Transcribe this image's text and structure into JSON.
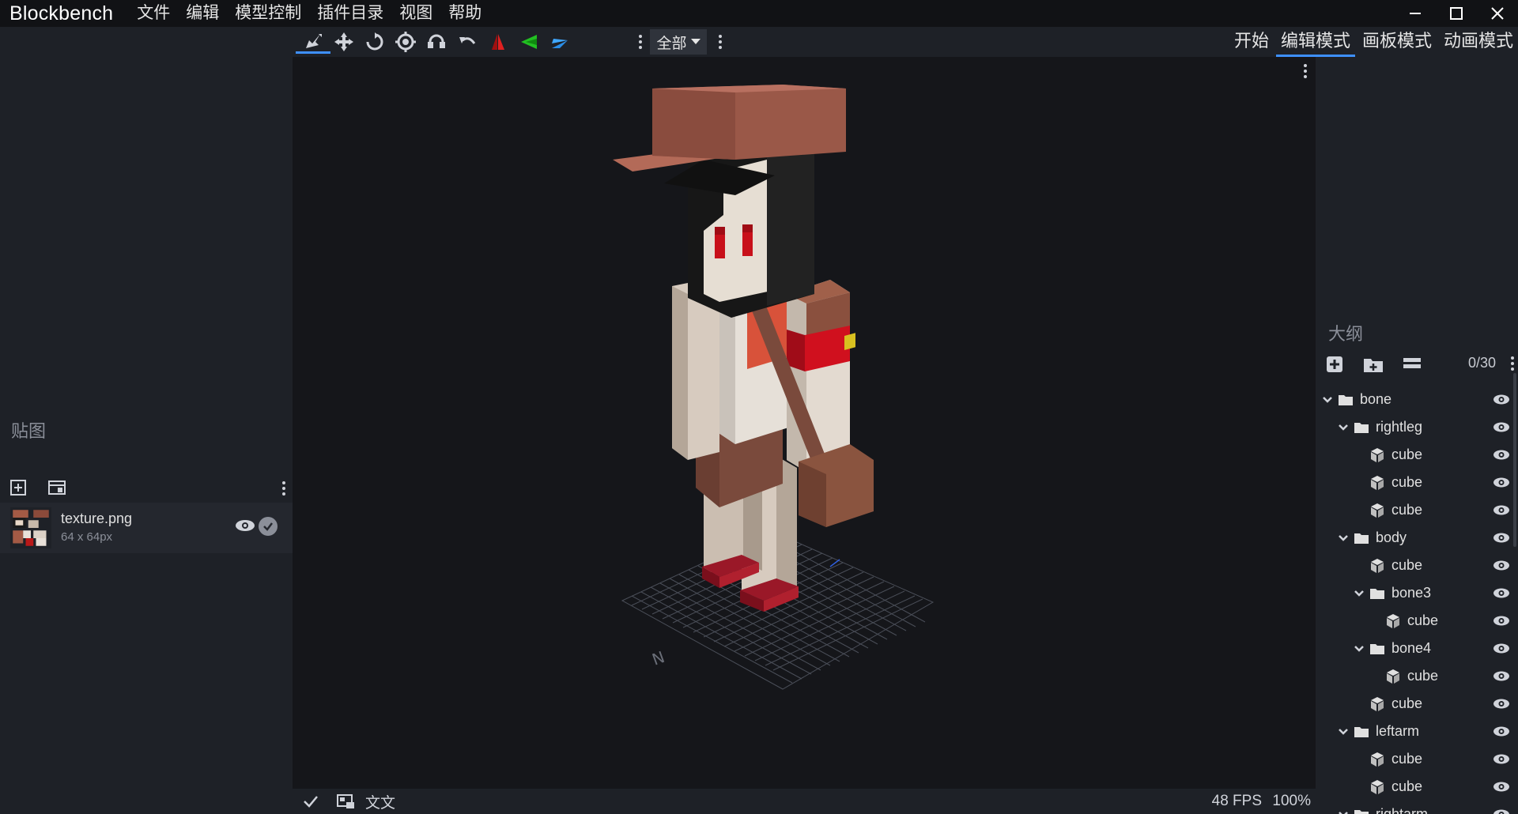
{
  "app": {
    "name": "Blockbench"
  },
  "menu": [
    "文件",
    "编辑",
    "模型控制",
    "插件目录",
    "视图",
    "帮助"
  ],
  "toolbar": {
    "select_label": "全部"
  },
  "modes": [
    "开始",
    "编辑模式",
    "画板模式",
    "动画模式"
  ],
  "left": {
    "textures_title": "贴图",
    "texture": {
      "name": "texture.png",
      "size": "64 x 64px"
    }
  },
  "outliner": {
    "title": "大纲",
    "count": "0/30",
    "items": [
      {
        "label": "bone",
        "type": "folder",
        "depth": 0
      },
      {
        "label": "rightleg",
        "type": "folder",
        "depth": 1
      },
      {
        "label": "cube",
        "type": "cube",
        "depth": 2
      },
      {
        "label": "cube",
        "type": "cube",
        "depth": 2
      },
      {
        "label": "cube",
        "type": "cube",
        "depth": 2
      },
      {
        "label": "body",
        "type": "folder",
        "depth": 1
      },
      {
        "label": "cube",
        "type": "cube",
        "depth": 2
      },
      {
        "label": "bone3",
        "type": "folder",
        "depth": 2
      },
      {
        "label": "cube",
        "type": "cube",
        "depth": 3
      },
      {
        "label": "bone4",
        "type": "folder",
        "depth": 2
      },
      {
        "label": "cube",
        "type": "cube",
        "depth": 3
      },
      {
        "label": "cube",
        "type": "cube",
        "depth": 2
      },
      {
        "label": "leftarm",
        "type": "folder",
        "depth": 1
      },
      {
        "label": "cube",
        "type": "cube",
        "depth": 2
      },
      {
        "label": "cube",
        "type": "cube",
        "depth": 2
      },
      {
        "label": "rightarm",
        "type": "folder",
        "depth": 1
      }
    ]
  },
  "status": {
    "label": "文文",
    "fps": "48 FPS",
    "zoom": "100%"
  },
  "colors": {
    "accent": "#3e90ff",
    "background": "#1e2127",
    "viewport": "#15161a"
  }
}
